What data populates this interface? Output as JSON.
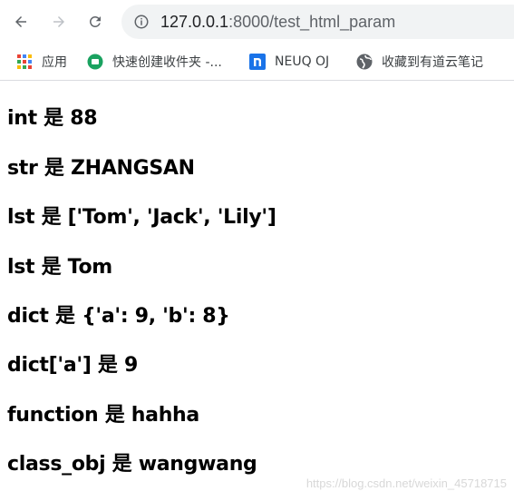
{
  "browser": {
    "url_host": "127.0.0.1",
    "url_rest": ":8000/test_html_param",
    "bookmarks": [
      {
        "label": "应用",
        "icon": "apps-grid-icon"
      },
      {
        "label": "快速创建收件夹 -...",
        "icon": "green-circle-icon"
      },
      {
        "label": "NEUQ OJ",
        "icon": "n-logo-icon"
      },
      {
        "label": "收藏到有道云笔记",
        "icon": "globe-icon"
      }
    ]
  },
  "lines": [
    "int 是 88",
    "str 是 ZHANGSAN",
    "lst 是 ['Tom', 'Jack', 'Lily']",
    "lst 是 Tom",
    "dict 是 {'a': 9, 'b': 8}",
    "dict['a'] 是 9",
    "function 是 hahha",
    "class_obj 是 wangwang"
  ],
  "watermark": "https://blog.csdn.net/weixin_45718715",
  "colors": {
    "omnibox_bg": "#f1f3f4",
    "icon_gray": "#5f6368",
    "n_logo_blue": "#1a73e8",
    "green_circle": "#1aa260"
  }
}
